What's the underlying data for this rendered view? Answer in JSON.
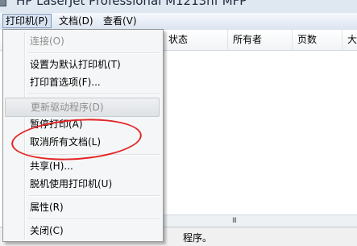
{
  "window": {
    "title": "HP LaserJet Professional M1213nf MFP"
  },
  "menubar": [
    {
      "label": "打印机(P)"
    },
    {
      "label": "文档(D)"
    },
    {
      "label": "查看(V)"
    }
  ],
  "columns": [
    {
      "label": "状态"
    },
    {
      "label": "所有者"
    },
    {
      "label": "页数"
    },
    {
      "label": "大小"
    }
  ],
  "scrollbar": {
    "grip": "III"
  },
  "status": {
    "text": "程序。"
  },
  "menu": {
    "items": [
      {
        "label": "连接(O)",
        "disabled": true
      },
      {
        "label": "设置为默认打印机(T)",
        "disabled": false
      },
      {
        "label": "打印首选项(F)...",
        "disabled": false
      },
      {
        "label": "更新驱动程序(D)",
        "disabled": true
      },
      {
        "label": "暂停打印(A)",
        "disabled": false
      },
      {
        "label": "取消所有文档(L)",
        "disabled": false
      },
      {
        "label": "共享(H)...",
        "disabled": false
      },
      {
        "label": "脱机使用打印机(U)",
        "disabled": false
      },
      {
        "label": "属性(R)",
        "disabled": false
      },
      {
        "label": "关闭(C)",
        "disabled": false
      }
    ]
  },
  "annotation": {
    "color": "#e32525"
  }
}
